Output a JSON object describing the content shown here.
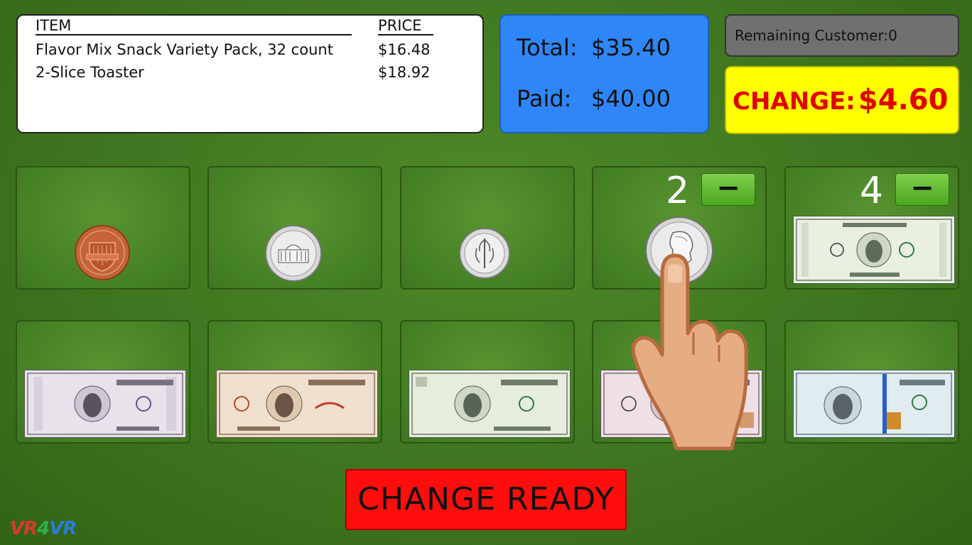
{
  "receipt": {
    "header_item": "ITEM",
    "header_price": "PRICE",
    "items": [
      {
        "name": "Flavor Mix Snack Variety Pack, 32 count",
        "price": "$16.48"
      },
      {
        "name": "2-Slice Toaster",
        "price": "$18.92"
      }
    ]
  },
  "totals": {
    "total_label": "Total:",
    "total_value": "$35.40",
    "paid_label": "Paid:",
    "paid_value": "$40.00"
  },
  "remaining": "Remaining Customer:0",
  "change": {
    "label": "CHANGE:",
    "amount": "$4.60"
  },
  "money_slots": [
    {
      "name": "penny",
      "icon": "penny-icon",
      "count": null
    },
    {
      "name": "nickel",
      "icon": "nickel-icon",
      "count": null
    },
    {
      "name": "dime",
      "icon": "dime-icon",
      "count": null
    },
    {
      "name": "quarter",
      "icon": "quarter-icon",
      "count": "2",
      "minus": "−"
    },
    {
      "name": "one-dollar",
      "icon": "one-dollar-bill-icon",
      "count": "4",
      "minus": "−"
    },
    {
      "name": "five-dollar",
      "icon": "five-dollar-bill-icon",
      "count": null
    },
    {
      "name": "ten-dollar",
      "icon": "ten-dollar-bill-icon",
      "count": null
    },
    {
      "name": "twenty-dollar",
      "icon": "twenty-dollar-bill-icon",
      "count": null
    },
    {
      "name": "fifty-dollar",
      "icon": "fifty-dollar-bill-icon",
      "count": null
    },
    {
      "name": "hundred-dollar",
      "icon": "hundred-dollar-bill-icon",
      "count": null
    }
  ],
  "ready_button": "CHANGE READY",
  "logo": {
    "part1": "VR",
    "part2": "4",
    "part3": "V",
    "part4": "R"
  },
  "colors": {
    "background": "#3f7620",
    "totals": "#2f86f8",
    "change_bg": "#ffff00",
    "change_text": "#e00000",
    "ready": "#ff0d0d"
  }
}
